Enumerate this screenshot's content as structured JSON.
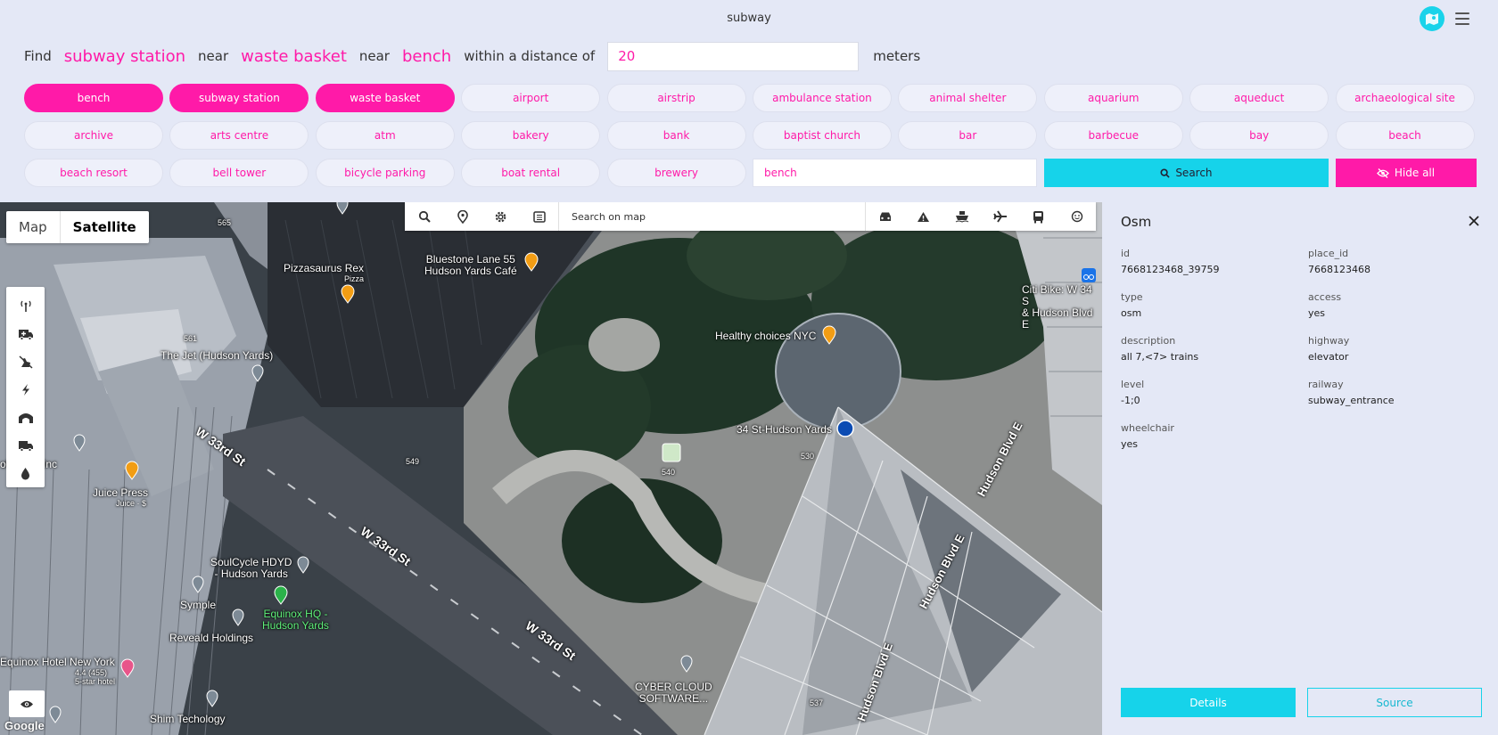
{
  "app": {
    "title": "subway"
  },
  "query": {
    "find": "Find",
    "target": "subway station",
    "near1": "near",
    "near_item1": "waste basket",
    "near2": "near",
    "near_item2": "bench",
    "within": "within a distance of",
    "distance_value": "20",
    "unit": "meters"
  },
  "chips": [
    {
      "label": "bench",
      "active": true
    },
    {
      "label": "subway station",
      "active": true
    },
    {
      "label": "waste basket",
      "active": true
    },
    {
      "label": "airport",
      "active": false
    },
    {
      "label": "airstrip",
      "active": false
    },
    {
      "label": "ambulance station",
      "active": false
    },
    {
      "label": "animal shelter",
      "active": false
    },
    {
      "label": "aquarium",
      "active": false
    },
    {
      "label": "aqueduct",
      "active": false
    },
    {
      "label": "archaeological site",
      "active": false
    },
    {
      "label": "archive",
      "active": false
    },
    {
      "label": "arts centre",
      "active": false
    },
    {
      "label": "atm",
      "active": false
    },
    {
      "label": "bakery",
      "active": false
    },
    {
      "label": "bank",
      "active": false
    },
    {
      "label": "baptist church",
      "active": false
    },
    {
      "label": "bar",
      "active": false
    },
    {
      "label": "barbecue",
      "active": false
    },
    {
      "label": "bay",
      "active": false
    },
    {
      "label": "beach",
      "active": false
    },
    {
      "label": "beach resort",
      "active": false
    },
    {
      "label": "bell tower",
      "active": false
    },
    {
      "label": "bicycle parking",
      "active": false
    },
    {
      "label": "boat rental",
      "active": false
    },
    {
      "label": "brewery",
      "active": false
    }
  ],
  "filter": {
    "value": "bench"
  },
  "buttons": {
    "search": "Search",
    "hide_all": "Hide all"
  },
  "map": {
    "map_label": "Map",
    "satellite_label": "Satellite",
    "search_placeholder": "Search on map",
    "google": "Google",
    "labels": {
      "pizzasaurus": "Pizzasaurus Rex",
      "pizza": "Pizza",
      "bluestone": "Bluestone Lane 55\nHudson Yards Café",
      "healthy": "Healthy choices NYC",
      "citibike": "Citi Bike: W 34 S\n& Hudson Blvd E",
      "jet": "The Jet (Hudson Yards)",
      "station": "34 St-Hudson Yards",
      "w33_1": "W 33rd St",
      "w33_2": "W 33rd St",
      "w33_3": "W 33rd St",
      "hblvd1": "Hudson Blvd E",
      "hblvd2": "Hudson Blvd E",
      "hblvd3": "Hudson Blvd E",
      "solutions": "olutions, Inc",
      "juice": "Juice Press",
      "juice_sub": "Juice · $",
      "soulcycle": "SoulCycle HDYD\n- Hudson Yards",
      "symple": "Symple",
      "equinox_hq": "Equinox HQ -\nHudson Yards",
      "reveald": "Reveald Holdings",
      "equinox_hotel": "Equinox Hotel New York",
      "equinox_rating": "4.4 (455)",
      "equinox_star": "5-star hotel",
      "shim": "Shim Techology",
      "cyber": "CYBER CLOUD\nSOFTWARE...",
      "n565": "565",
      "n561": "561",
      "n549": "549",
      "n540": "540",
      "n530": "530",
      "n537": "537"
    }
  },
  "panel": {
    "title": "Osm",
    "fields": [
      {
        "key": "id",
        "value": "7668123468_39759"
      },
      {
        "key": "place_id",
        "value": "7668123468"
      },
      {
        "key": "type",
        "value": "osm"
      },
      {
        "key": "access",
        "value": "yes"
      },
      {
        "key": "description",
        "value": "all 7,<7> trains"
      },
      {
        "key": "highway",
        "value": "elevator"
      },
      {
        "key": "level",
        "value": "-1;0"
      },
      {
        "key": "railway",
        "value": "subway_entrance"
      },
      {
        "key": "wheelchair",
        "value": "yes"
      }
    ],
    "details_label": "Details",
    "source_label": "Source"
  },
  "colors": {
    "accent_pink": "#ff1aa8",
    "accent_cyan": "#16d3ea",
    "background": "#e4e8f6"
  }
}
